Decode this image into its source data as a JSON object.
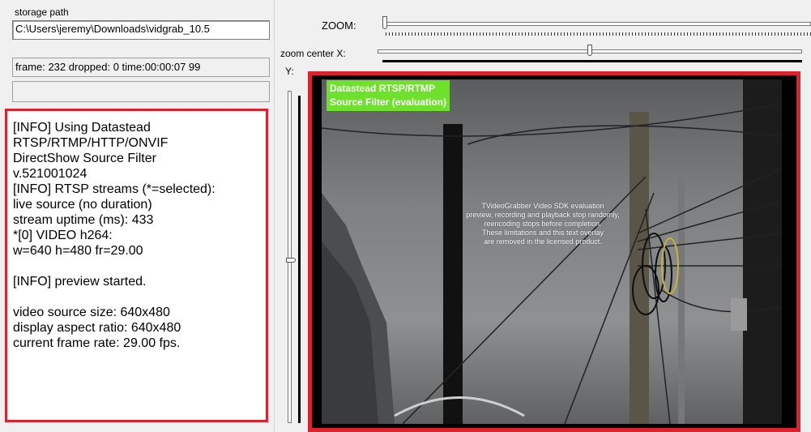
{
  "left_panel": {
    "storage_label": "storage path",
    "storage_value": "C:\\Users\\jeremy\\Downloads\\vidgrab_10.5",
    "status_text": "frame: 232 dropped: 0 time:00:00:07 99",
    "empty_field": "",
    "log_lines": [
      "[INFO] Using Datastead",
      "RTSP/RTMP/HTTP/ONVIF",
      "DirectShow Source Filter",
      "v.521001024",
      "[INFO] RTSP streams (*=selected):",
      "live source (no duration)",
      "stream uptime (ms): 433",
      "*[0] VIDEO h264:",
      "w=640 h=480 fr=29.00",
      "",
      "[INFO] preview started.",
      "",
      "video source size: 640x480",
      "display aspect ratio: 640x480",
      "current frame rate: 29.00 fps."
    ]
  },
  "right_panel": {
    "zoom_label": "ZOOM:",
    "zoom_value": 0.0,
    "zoom_center_x_label": "zoom center X:",
    "zoom_center_x_value": 0.5,
    "y_label": "Y:",
    "zoom_center_y_value": 0.5
  },
  "video": {
    "badge_text": "Datastead RTSP/RTMP\nSource Filter (evaluation)",
    "watermark_lines": [
      "TVideoGrabber Video SDK evaluation",
      "preview, recording and playback stop randomly,",
      "reencoding stops before completion.",
      "These limitations and this text overlay",
      "are removed in the licensed product."
    ]
  },
  "colors": {
    "highlight": "#d9232e",
    "badge": "#6ee12d"
  }
}
